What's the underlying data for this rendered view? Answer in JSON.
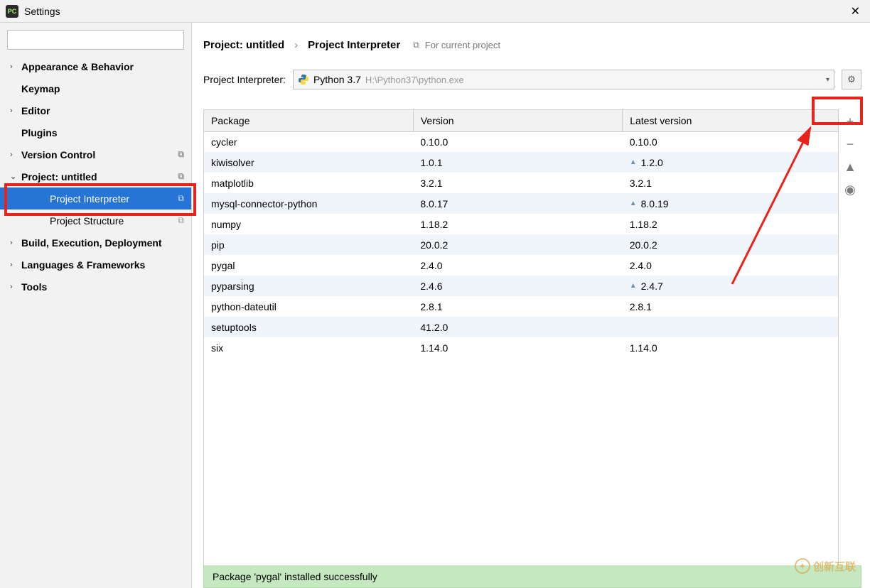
{
  "window": {
    "title": "Settings",
    "app_icon_text": "PC"
  },
  "sidebar": {
    "search_placeholder": "",
    "items": [
      {
        "label": "Appearance & Behavior",
        "arrow": "›",
        "indent": 0
      },
      {
        "label": "Keymap",
        "arrow": "",
        "indent": 0
      },
      {
        "label": "Editor",
        "arrow": "›",
        "indent": 0
      },
      {
        "label": "Plugins",
        "arrow": "",
        "indent": 0
      },
      {
        "label": "Version Control",
        "arrow": "›",
        "indent": 0,
        "copy": true
      },
      {
        "label": "Project: untitled",
        "arrow": "⌄",
        "indent": 0,
        "copy": true
      },
      {
        "label": "Project Interpreter",
        "arrow": "",
        "indent": 1,
        "copy": true,
        "selected": true
      },
      {
        "label": "Project Structure",
        "arrow": "",
        "indent": 1,
        "copy": true
      },
      {
        "label": "Build, Execution, Deployment",
        "arrow": "›",
        "indent": 0
      },
      {
        "label": "Languages & Frameworks",
        "arrow": "›",
        "indent": 0
      },
      {
        "label": "Tools",
        "arrow": "›",
        "indent": 0
      }
    ]
  },
  "breadcrumbs": {
    "a": "Project: untitled",
    "sep": "›",
    "b": "Project Interpreter",
    "for_current": "For current project"
  },
  "interpreter": {
    "label": "Project Interpreter:",
    "name": "Python 3.7",
    "path": "H:\\Python37\\python.exe"
  },
  "table": {
    "columns": [
      "Package",
      "Version",
      "Latest version"
    ],
    "rows": [
      {
        "pkg": "cycler",
        "ver": "0.10.0",
        "latest": "0.10.0",
        "up": false
      },
      {
        "pkg": "kiwisolver",
        "ver": "1.0.1",
        "latest": "1.2.0",
        "up": true
      },
      {
        "pkg": "matplotlib",
        "ver": "3.2.1",
        "latest": "3.2.1",
        "up": false
      },
      {
        "pkg": "mysql-connector-python",
        "ver": "8.0.17",
        "latest": "8.0.19",
        "up": true
      },
      {
        "pkg": "numpy",
        "ver": "1.18.2",
        "latest": "1.18.2",
        "up": false
      },
      {
        "pkg": "pip",
        "ver": "20.0.2",
        "latest": "20.0.2",
        "up": false
      },
      {
        "pkg": "pygal",
        "ver": "2.4.0",
        "latest": "2.4.0",
        "up": false
      },
      {
        "pkg": "pyparsing",
        "ver": "2.4.6",
        "latest": "2.4.7",
        "up": true
      },
      {
        "pkg": "python-dateutil",
        "ver": "2.8.1",
        "latest": "2.8.1",
        "up": false
      },
      {
        "pkg": "setuptools",
        "ver": "41.2.0",
        "latest": "",
        "up": false
      },
      {
        "pkg": "six",
        "ver": "1.14.0",
        "latest": "1.14.0",
        "up": false
      }
    ]
  },
  "status": "Package 'pygal' installed successfully",
  "watermark": "创新互联"
}
